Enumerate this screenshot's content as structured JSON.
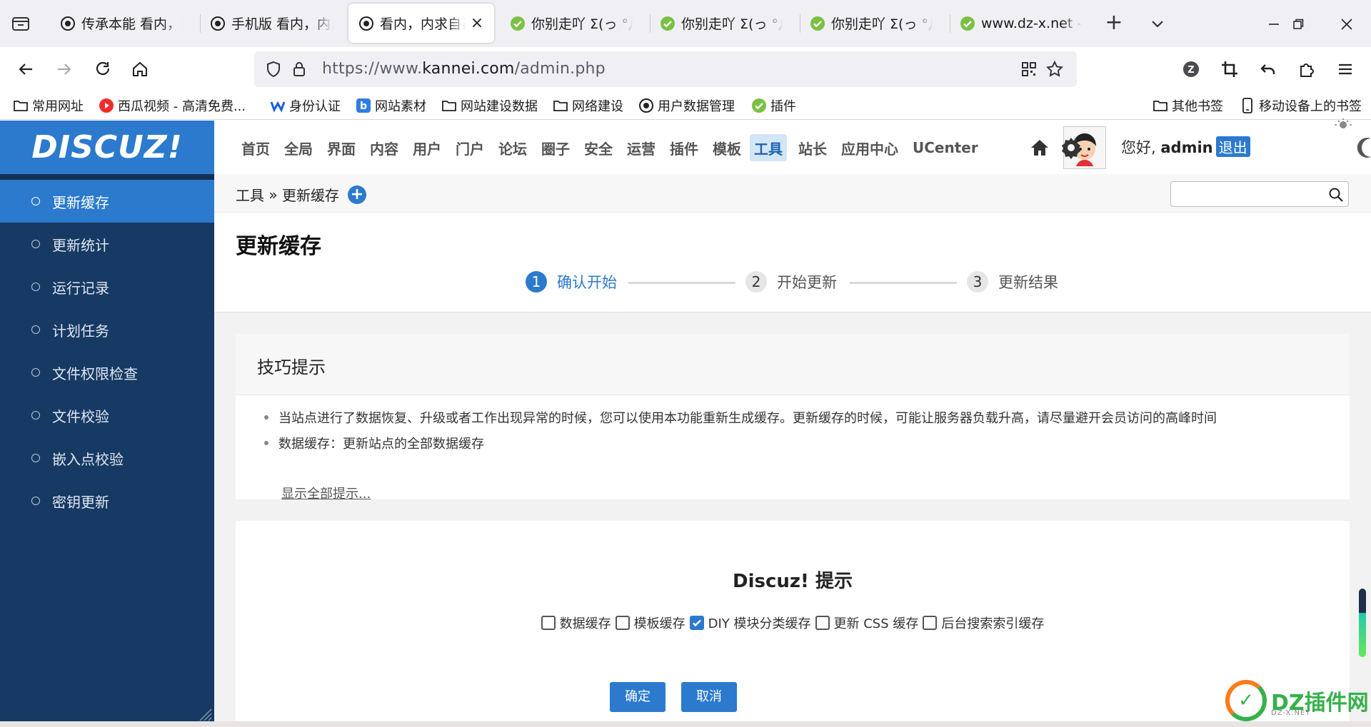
{
  "browser": {
    "tabs": [
      {
        "title": "传承本能 看内，内求自己"
      },
      {
        "title": "手机版 看内，内求自己"
      },
      {
        "title": "看内，内求自己"
      },
      {
        "title": "你别走吖 Σ(っ °Д °;)っ"
      },
      {
        "title": "你别走吖 Σ(っ °Д °;)っ"
      },
      {
        "title": "你别走吖 Σ(っ °Д °;)っ"
      },
      {
        "title": "www.dz-x.net - Sit"
      }
    ],
    "url_prefix": "https://www.",
    "url_host": "kannei.com",
    "url_path": "/admin.php",
    "bookmarks": [
      {
        "label": "常用网址",
        "icon": "folder-icon"
      },
      {
        "label": "西瓜视频 - 高清免费...",
        "icon": "xigua-icon"
      },
      {
        "label": "身份认证",
        "icon": "w-logo-icon"
      },
      {
        "label": "网站素材",
        "icon": "b-logo-icon"
      },
      {
        "label": "网站建设数据",
        "icon": "folder-icon"
      },
      {
        "label": "网络建设",
        "icon": "folder-icon"
      },
      {
        "label": "用户数据管理",
        "icon": "site-icon"
      },
      {
        "label": "插件",
        "icon": "check-icon"
      }
    ],
    "bookmarks_right": [
      {
        "label": "其他书签",
        "icon": "folder-icon"
      },
      {
        "label": "移动设备上的书签",
        "icon": "phone-icon"
      }
    ]
  },
  "admin": {
    "logo": "DISCUZ!",
    "topnav": [
      "首页",
      "全局",
      "界面",
      "内容",
      "用户",
      "门户",
      "论坛",
      "圈子",
      "安全",
      "运营",
      "插件",
      "模板",
      "工具",
      "站长",
      "应用中心",
      "UCenter"
    ],
    "active_topnav": "工具",
    "greeting_prefix": "您好,",
    "username": "admin",
    "logout": "退出",
    "sidebar": [
      "更新缓存",
      "更新统计",
      "运行记录",
      "计划任务",
      "文件权限检查",
      "文件校验",
      "嵌入点校验",
      "密钥更新"
    ],
    "breadcrumb_section": "工具",
    "breadcrumb_sep": "»",
    "breadcrumb_page": "更新缓存",
    "search_placeholder": "",
    "page_title": "更新缓存",
    "steps": [
      {
        "num": "1",
        "label": "确认开始"
      },
      {
        "num": "2",
        "label": "开始更新"
      },
      {
        "num": "3",
        "label": "更新结果"
      }
    ],
    "tips_title": "技巧提示",
    "tips": [
      "当站点进行了数据恢复、升级或者工作出现异常的时候，您可以使用本功能重新生成缓存。更新缓存的时候，可能让服务器负载升高，请尽量避开会员访问的高峰时间",
      "数据缓存：更新站点的全部数据缓存"
    ],
    "show_all": "显示全部提示...",
    "card_title": "Discuz! 提示",
    "options": [
      {
        "label": "数据缓存",
        "checked": false
      },
      {
        "label": "模板缓存",
        "checked": false
      },
      {
        "label": "DIY 模块分类缓存",
        "checked": true
      },
      {
        "label": "更新 CSS 缓存",
        "checked": false
      },
      {
        "label": "后台搜索索引缓存",
        "checked": false
      }
    ],
    "confirm": "确定",
    "cancel": "取消"
  },
  "watermark": {
    "text": "DZ插件网",
    "sub": "DZ-X.NET"
  },
  "colors": {
    "accent": "#2b7acd",
    "sidebar": "#173a64",
    "browser_chrome": "#f0f0f4"
  }
}
